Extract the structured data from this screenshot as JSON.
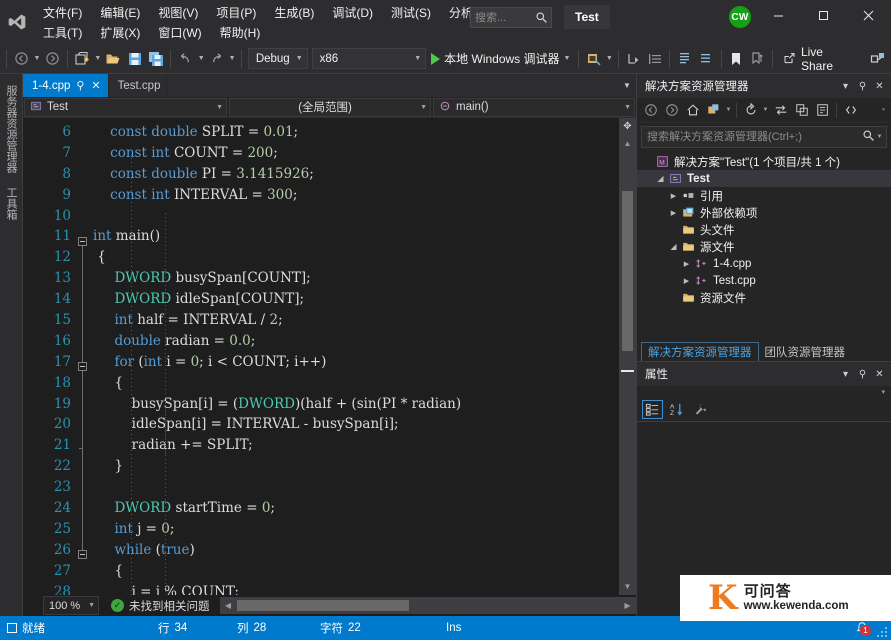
{
  "window": {
    "project_chip": "Test",
    "avatar_initials": "CW",
    "minimize": "—",
    "maximize": "▢",
    "close": "✕"
  },
  "menu": {
    "row1": [
      "文件(F)",
      "编辑(E)",
      "视图(V)",
      "项目(P)",
      "生成(B)",
      "调试(D)",
      "测试(S)",
      "分析(N)"
    ],
    "row2": [
      "工具(T)",
      "扩展(X)",
      "窗口(W)",
      "帮助(H)"
    ]
  },
  "search": {
    "placeholder": "搜索...",
    "value": ""
  },
  "toolbar": {
    "configuration": "Debug",
    "platform": "x86",
    "run_label": "本地 Windows 调试器",
    "live_share": "Live Share"
  },
  "left_dock": {
    "tabs": [
      "服务器资源管理器",
      "工具箱"
    ]
  },
  "editor": {
    "tabs": [
      {
        "label": "1-4.cpp",
        "active": true,
        "pin": "⚲",
        "close": "✕"
      },
      {
        "label": "Test.cpp",
        "active": false
      }
    ],
    "nav": {
      "project": "Test",
      "scope": "(全局范围)",
      "member": "main()"
    },
    "zoom": "100 %",
    "issues": "未找到相关问题",
    "first_line": 6,
    "lines": [
      {
        "n": 6,
        "tokens": [
          [
            "pl",
            "    "
          ],
          [
            "kw",
            "const"
          ],
          [
            "pl",
            " "
          ],
          [
            "kw",
            "double"
          ],
          [
            "pl",
            " SPLIT = "
          ],
          [
            "nm",
            "0.01"
          ],
          [
            "pl",
            ";"
          ]
        ]
      },
      {
        "n": 7,
        "tokens": [
          [
            "pl",
            "    "
          ],
          [
            "kw",
            "const"
          ],
          [
            "pl",
            " "
          ],
          [
            "kw",
            "int"
          ],
          [
            "pl",
            " COUNT = "
          ],
          [
            "nm",
            "200"
          ],
          [
            "pl",
            ";"
          ]
        ]
      },
      {
        "n": 8,
        "tokens": [
          [
            "pl",
            "    "
          ],
          [
            "kw",
            "const"
          ],
          [
            "pl",
            " "
          ],
          [
            "kw",
            "double"
          ],
          [
            "pl",
            " PI = "
          ],
          [
            "nm",
            "3.1415926"
          ],
          [
            "pl",
            ";"
          ]
        ]
      },
      {
        "n": 9,
        "tokens": [
          [
            "pl",
            "    "
          ],
          [
            "kw",
            "const"
          ],
          [
            "pl",
            " "
          ],
          [
            "kw",
            "int"
          ],
          [
            "pl",
            " INTERVAL = "
          ],
          [
            "nm",
            "300"
          ],
          [
            "pl",
            ";"
          ]
        ]
      },
      {
        "n": 10,
        "tokens": [
          [
            "pl",
            ""
          ]
        ]
      },
      {
        "n": 11,
        "tokens": [
          [
            "kw",
            "int"
          ],
          [
            "pl",
            " main()"
          ]
        ]
      },
      {
        "n": 12,
        "tokens": [
          [
            "pl",
            " {"
          ]
        ]
      },
      {
        "n": 13,
        "tokens": [
          [
            "pl",
            "     "
          ],
          [
            "ty",
            "DWORD"
          ],
          [
            "pl",
            " busySpan[COUNT];"
          ]
        ]
      },
      {
        "n": 14,
        "tokens": [
          [
            "pl",
            "     "
          ],
          [
            "ty",
            "DWORD"
          ],
          [
            "pl",
            " idleSpan[COUNT];"
          ]
        ]
      },
      {
        "n": 15,
        "tokens": [
          [
            "pl",
            "     "
          ],
          [
            "kw",
            "int"
          ],
          [
            "pl",
            " half = INTERVAL / "
          ],
          [
            "nm",
            "2"
          ],
          [
            "pl",
            ";"
          ]
        ]
      },
      {
        "n": 16,
        "tokens": [
          [
            "pl",
            "     "
          ],
          [
            "kw",
            "double"
          ],
          [
            "pl",
            " radian = "
          ],
          [
            "nm",
            "0.0"
          ],
          [
            "pl",
            ";"
          ]
        ]
      },
      {
        "n": 17,
        "tokens": [
          [
            "pl",
            "     "
          ],
          [
            "kw",
            "for"
          ],
          [
            "pl",
            " ("
          ],
          [
            "kw",
            "int"
          ],
          [
            "pl",
            " i = "
          ],
          [
            "nm",
            "0"
          ],
          [
            "pl",
            "; i < COUNT; i++)"
          ]
        ]
      },
      {
        "n": 18,
        "tokens": [
          [
            "pl",
            "     {"
          ]
        ]
      },
      {
        "n": 19,
        "tokens": [
          [
            "pl",
            "         busySpan[i] = ("
          ],
          [
            "ty",
            "DWORD"
          ],
          [
            "pl",
            ")(half + (sin(PI * radian)"
          ]
        ]
      },
      {
        "n": 20,
        "tokens": [
          [
            "pl",
            "         idleSpan[i] = INTERVAL - busySpan[i];"
          ]
        ]
      },
      {
        "n": 21,
        "tokens": [
          [
            "pl",
            "         radian += SPLIT;"
          ]
        ]
      },
      {
        "n": 22,
        "tokens": [
          [
            "pl",
            "     }"
          ]
        ]
      },
      {
        "n": 23,
        "tokens": [
          [
            "pl",
            ""
          ]
        ]
      },
      {
        "n": 24,
        "tokens": [
          [
            "pl",
            "     "
          ],
          [
            "ty",
            "DWORD"
          ],
          [
            "pl",
            " startTime = "
          ],
          [
            "nm",
            "0"
          ],
          [
            "pl",
            ";"
          ]
        ]
      },
      {
        "n": 25,
        "tokens": [
          [
            "pl",
            "     "
          ],
          [
            "kw",
            "int"
          ],
          [
            "pl",
            " j = "
          ],
          [
            "nm",
            "0"
          ],
          [
            "pl",
            ";"
          ]
        ]
      },
      {
        "n": 26,
        "tokens": [
          [
            "pl",
            "     "
          ],
          [
            "kw",
            "while"
          ],
          [
            "pl",
            " ("
          ],
          [
            "kw",
            "true"
          ],
          [
            "pl",
            ")"
          ]
        ]
      },
      {
        "n": 27,
        "tokens": [
          [
            "pl",
            "     {"
          ]
        ]
      },
      {
        "n": 28,
        "tokens": [
          [
            "pl",
            "         j = j % COUNT;"
          ]
        ]
      }
    ]
  },
  "solution_explorer": {
    "title": "解决方案资源管理器",
    "search_placeholder": "搜索解决方案资源管理器(Ctrl+;)",
    "tree": [
      {
        "indent": 0,
        "arrow": "",
        "icon": "solution-icon",
        "label": "解决方案\"Test\"(1 个项目/共 1 个)",
        "bold": false,
        "selected": false
      },
      {
        "indent": 1,
        "arrow": "▲",
        "icon": "project-icon",
        "label": "Test",
        "bold": true,
        "selected": true
      },
      {
        "indent": 2,
        "arrow": "▶",
        "icon": "references-icon",
        "label": "引用",
        "bold": false,
        "selected": false
      },
      {
        "indent": 2,
        "arrow": "▶",
        "icon": "external-icon",
        "label": "外部依赖项",
        "bold": false,
        "selected": false
      },
      {
        "indent": 2,
        "arrow": "",
        "icon": "folder-icon",
        "label": "头文件",
        "bold": false,
        "selected": false
      },
      {
        "indent": 2,
        "arrow": "▲",
        "icon": "folder-icon",
        "label": "源文件",
        "bold": false,
        "selected": false
      },
      {
        "indent": 3,
        "arrow": "▶",
        "icon": "cpp-icon",
        "label": "1-4.cpp",
        "bold": false,
        "selected": false
      },
      {
        "indent": 3,
        "arrow": "▶",
        "icon": "cpp-icon",
        "label": "Test.cpp",
        "bold": false,
        "selected": false
      },
      {
        "indent": 2,
        "arrow": "",
        "icon": "folder-icon",
        "label": "资源文件",
        "bold": false,
        "selected": false
      }
    ],
    "dock_tabs": [
      {
        "label": "解决方案资源管理器",
        "active": true
      },
      {
        "label": "团队资源管理器",
        "active": false
      }
    ]
  },
  "properties": {
    "title": "属性"
  },
  "statusbar": {
    "ready": "就绪",
    "line_label": "行",
    "line_value": "34",
    "col_label": "列",
    "col_value": "28",
    "char_label": "字符",
    "char_value": "22",
    "insert_mode": "Ins",
    "notification_count": "1"
  },
  "watermark": {
    "mark": "K",
    "cn": "可问答",
    "url": "www.kewenda.com"
  },
  "colors": {
    "accent": "#007acc",
    "chrome": "#2d2d30",
    "panel": "#252526",
    "editor_bg": "#1e1e1e",
    "keyword": "#569cd6",
    "type": "#4ec9b0",
    "number": "#b5cea8",
    "linenum": "#2b91af",
    "avatar": "#16a016"
  }
}
